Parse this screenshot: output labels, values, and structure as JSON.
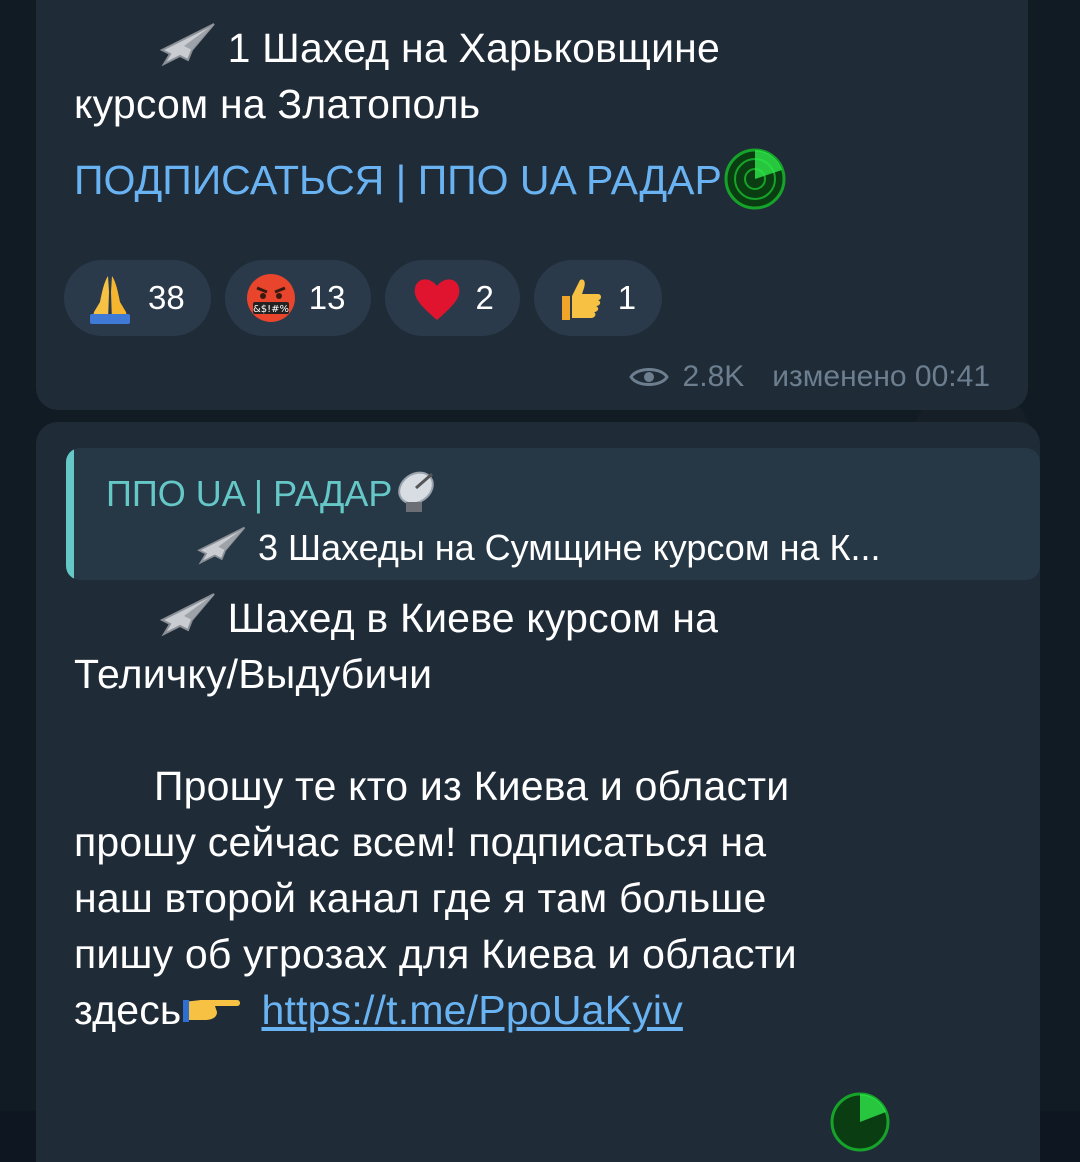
{
  "messages": [
    {
      "text_line_1": "1 Шахед на Харьковщине",
      "text_line_2": "курсом на Златополь",
      "subscribe_link": "ПОДПИСАТЬСЯ | ППО UA РАДАР",
      "reactions": [
        {
          "emoji": "folded-hands",
          "count": "38"
        },
        {
          "emoji": "cursing-face",
          "count": "13"
        },
        {
          "emoji": "red-heart",
          "count": "2"
        },
        {
          "emoji": "thumbs-up",
          "count": "1"
        }
      ],
      "views": "2.8K",
      "edited_time": "изменено 00:41"
    },
    {
      "reply": {
        "channel_name": "ППО UA | РАДАР",
        "preview_text": "3 Шахеды на Сумщине курсом на К..."
      },
      "text_line_1": "Шахед в Киеве курсом на",
      "text_line_2": "Теличку/Выдубичи",
      "para_line_1": "Прошу те кто из Киева и области",
      "para_line_2": "прошу сейчас всем! подписаться на",
      "para_line_3": "наш второй канал где я там больше",
      "para_line_4": "пишу об угрозах для Киева и области",
      "para_line_5_prefix": "здесь",
      "url": "https://t.me/PpoUaKyiv"
    }
  ],
  "colors": {
    "background": "#111b24",
    "bubble": "#1f2b37",
    "link": "#6ab3f3",
    "reply_accent": "#65c7c6",
    "meta": "#6d7f8f"
  }
}
